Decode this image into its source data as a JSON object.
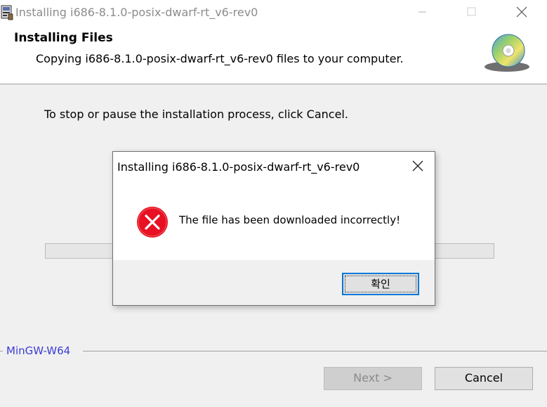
{
  "window": {
    "title": "Installing i686-8.1.0-posix-dwarf-rt_v6-rev0"
  },
  "header": {
    "title": "Installing Files",
    "subtitle": "Copying i686-8.1.0-posix-dwarf-rt_v6-rev0 files to your computer."
  },
  "body": {
    "instruction": "To stop or pause the installation process, click Cancel."
  },
  "footer": {
    "branding": "MinGW-W64",
    "next_label": "Next >",
    "cancel_label": "Cancel"
  },
  "dialog": {
    "title": "Installing i686-8.1.0-posix-dwarf-rt_v6-rev0",
    "message": "The file has been downloaded incorrectly!",
    "ok_label": "확인"
  },
  "colors": {
    "error_red": "#e81123",
    "branding_blue": "#3c3cd6",
    "focus_blue": "#0078d7"
  }
}
